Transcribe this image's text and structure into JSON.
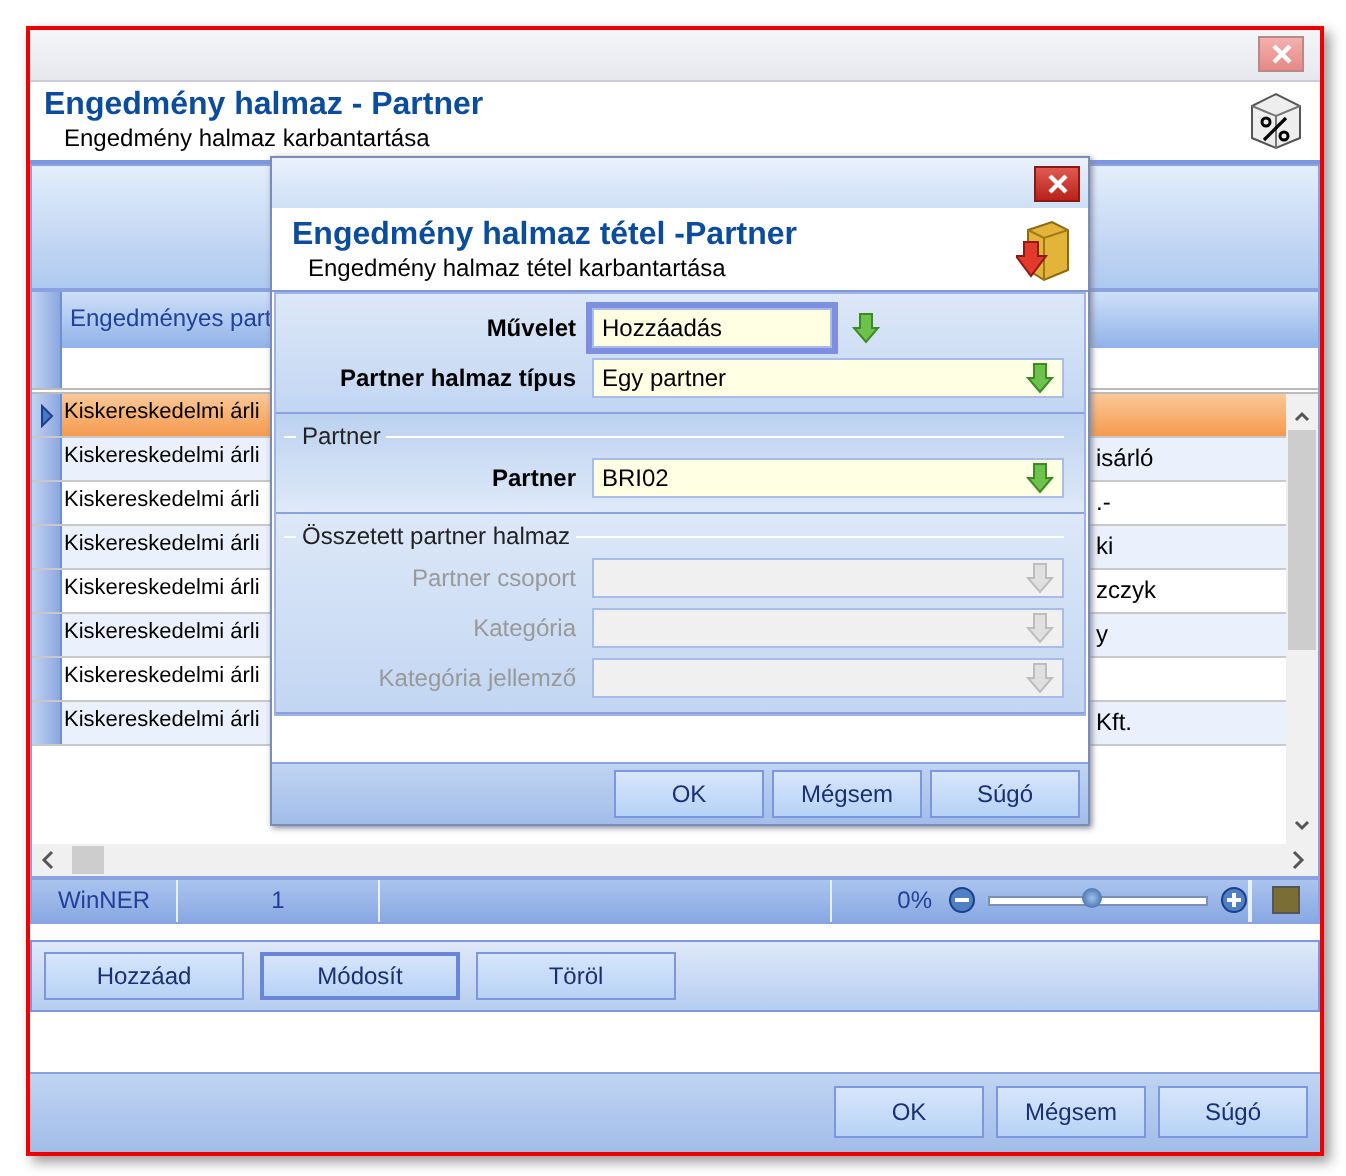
{
  "window": {
    "title": "Engedmény halmaz - Partner",
    "subtitle": "Engedmény halmaz karbantartása"
  },
  "grid": {
    "columns": [
      "Engedményes part"
    ],
    "rows": [
      {
        "column_1": "Kiskereskedelmi árli",
        "selected": true
      },
      {
        "column_1": "Kiskereskedelmi árli",
        "column_2": "isárló",
        "selected": false
      },
      {
        "column_1": "Kiskereskedelmi árli",
        "column_2": ".-",
        "selected": false
      },
      {
        "column_1": "Kiskereskedelmi árli",
        "column_2": "ki",
        "selected": false
      },
      {
        "column_1": "Kiskereskedelmi árli",
        "column_2": "zczyk",
        "selected": false
      },
      {
        "column_1": "Kiskereskedelmi árli",
        "column_2": "y",
        "selected": false
      },
      {
        "column_1": "Kiskereskedelmi árli",
        "selected": false
      },
      {
        "column_1": "Kiskereskedelmi árli",
        "column_2": "Kft.",
        "selected": false
      }
    ]
  },
  "status_bar": {
    "app": "WinNER",
    "count": "1",
    "zoom": "0%",
    "level": 0.47
  },
  "actions": [
    {
      "label": "Hozzáad",
      "focused": false
    },
    {
      "label": "Módosít",
      "focused": true
    },
    {
      "label": "Töröl",
      "focused": false
    }
  ],
  "buttons": [
    "OK",
    "Mégsem",
    "Súgó"
  ],
  "dialog": {
    "title": "Engedmény halmaz tétel -Partner",
    "subtitle": "Engedmény halmaz tétel karbantartása",
    "sections": [
      {
        "fields": [
          {
            "label": "Művelet",
            "value": "Hozzáadás",
            "focused": true,
            "disabled": false
          },
          {
            "label": "Partner halmaz típus",
            "value": "Egy partner",
            "focused": false,
            "disabled": false
          }
        ]
      },
      {
        "title": "Partner",
        "fields": [
          {
            "label": "Partner",
            "value": "BRI02",
            "focused": false,
            "disabled": false
          }
        ]
      },
      {
        "title": "Összetett partner halmaz",
        "fields": [
          {
            "label": "Partner csoport",
            "focused": false,
            "disabled": true
          },
          {
            "label": "Kategória",
            "focused": false,
            "disabled": true
          },
          {
            "label": "Kategória jellemző",
            "focused": false,
            "disabled": true
          }
        ]
      }
    ],
    "buttons": [
      "OK",
      "Mégsem",
      "Súgó"
    ]
  }
}
